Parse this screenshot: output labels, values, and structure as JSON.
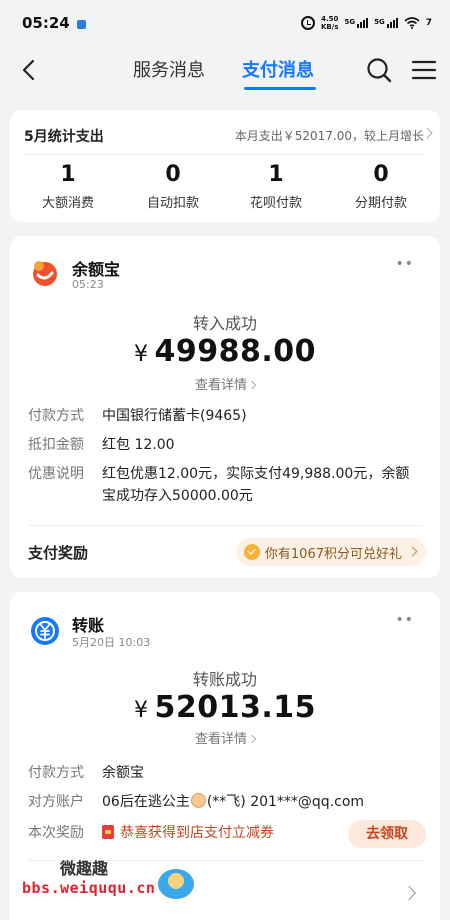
{
  "status_bar": {
    "time": "05:24",
    "speed_value": "4.50",
    "speed_unit": "KB/s",
    "net1": "5G",
    "net2": "5G",
    "battery": "7"
  },
  "nav": {
    "tabs": [
      "服务消息",
      "支付消息"
    ],
    "active_tab": "支付消息"
  },
  "stats": {
    "title": "5月统计支出",
    "summary": "本月支出￥52017.00，较上月增长",
    "items": [
      {
        "count": "1",
        "label": "大额消费"
      },
      {
        "count": "0",
        "label": "自动扣款"
      },
      {
        "count": "1",
        "label": "花呗付款"
      },
      {
        "count": "0",
        "label": "分期付款"
      }
    ]
  },
  "payment1": {
    "merchant": "余额宝",
    "time": "05:23",
    "status": "转入成功",
    "currency": "¥",
    "amount": "49988.00",
    "detail_link": "查看详情",
    "rows": [
      {
        "key": "付款方式",
        "value": "中国银行储蓄卡(9465)"
      },
      {
        "key": "抵扣金额",
        "value": "红包 12.00"
      },
      {
        "key": "优惠说明",
        "value": "红包优惠12.00元，实际支付49,988.00元，余额宝成功存入50000.00元"
      }
    ],
    "reward_title": "支付奖励",
    "reward_points": "你有1067积分可兑好礼"
  },
  "payment2": {
    "merchant": "转账",
    "time": "5月20日 10:03",
    "status": "转账成功",
    "currency": "¥",
    "amount": "52013.15",
    "detail_link": "查看详情",
    "rows": [
      {
        "key": "付款方式",
        "value": "余额宝"
      },
      {
        "key": "对方账户",
        "value_prefix": "06后在逃公主",
        "value_suffix": "(**飞) 201***@qq.com"
      }
    ],
    "reward_key": "本次奖励",
    "reward_text": "恭喜获得到店支付立减券",
    "claim_button": "去领取"
  },
  "watermark": {
    "top": "微趣趣",
    "url": "bbs.weiququ.cn"
  },
  "colors": {
    "accent": "#1677ff",
    "yuebao": "#f0502a",
    "transfer": "#1677ff",
    "claim": "#c8441e"
  }
}
